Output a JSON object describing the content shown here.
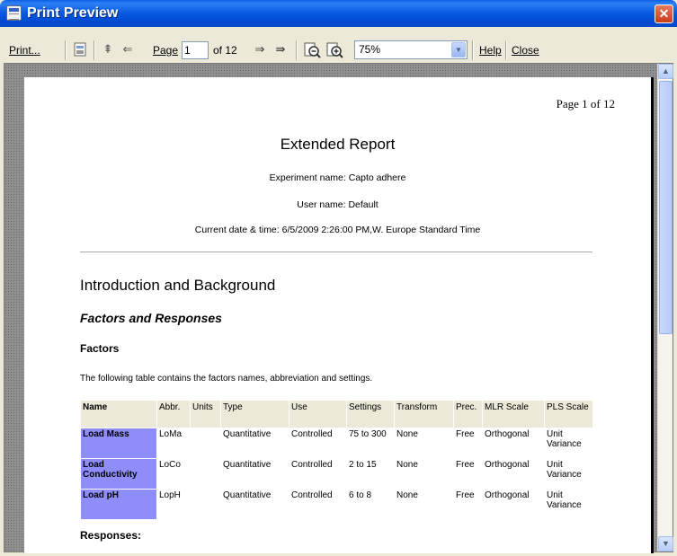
{
  "window": {
    "title": "Print Preview",
    "close_glyph": "✕"
  },
  "toolbar": {
    "print_label": "Print...",
    "first_icon": "⇞",
    "prev_icon": "⇐",
    "page_label": "Page",
    "page_value": "1",
    "of_label": "of 12",
    "next_icon": "⇒",
    "last_icon": "⇛",
    "zoom_value": "75%",
    "help_label": "Help",
    "close_label": "Close"
  },
  "page": {
    "page_number": "Page 1 of 12",
    "report_title": "Extended Report",
    "experiment": "Experiment name: Capto adhere",
    "user": "User name: Default",
    "datetime": "Current date & time: 6/5/2009 2:26:00 PM,W. Europe Standard Time",
    "section_title": "Introduction and Background",
    "subsection_title": "Factors and Responses",
    "factors_heading": "Factors",
    "factors_intro": "The following table contains the factors names, abbreviation and settings.",
    "responses_heading": "Responses:",
    "table": {
      "headers": [
        "Name",
        "Abbr.",
        "Units",
        "Type",
        "Use",
        "Settings",
        "Transform",
        "Prec.",
        "MLR Scale",
        "PLS Scale"
      ],
      "rows": [
        [
          "Load Mass",
          "LoMa",
          "",
          "Quantitative",
          "Controlled",
          "75 to 300",
          "None",
          "Free",
          "Orthogonal",
          "Unit Variance"
        ],
        [
          "Load Conductivity",
          "LoCo",
          "",
          "Quantitative",
          "Controlled",
          "2 to 15",
          "None",
          "Free",
          "Orthogonal",
          "Unit Variance"
        ],
        [
          "Load pH",
          "LopH",
          "",
          "Quantitative",
          "Controlled",
          "6 to 8",
          "None",
          "Free",
          "Orthogonal",
          "Unit Variance"
        ]
      ]
    }
  },
  "colors": {
    "title_bar": "#0757e0",
    "name_cell": "#8f8dfa",
    "header_cell": "#ece9d8"
  }
}
